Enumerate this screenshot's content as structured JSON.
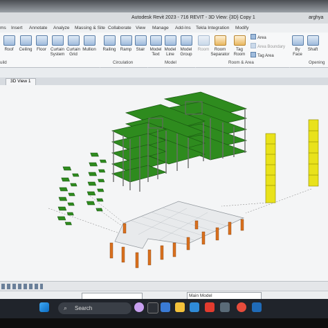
{
  "window": {
    "title": "Autodesk Revit 2023 - 716 REVIT - 3D View: {3D} Copy 1",
    "user": "arghya"
  },
  "tabs": [
    "ms",
    "Insert",
    "Annotate",
    "Analyze",
    "Massing & Site",
    "Collaborate",
    "View",
    "Manage",
    "Add-Ins",
    "Tekla Integration",
    "Modify"
  ],
  "ribbon": {
    "buttons": [
      {
        "label": "Roof"
      },
      {
        "label": "Ceiling"
      },
      {
        "label": "Floor"
      },
      {
        "label": "Curtain\nSystem"
      },
      {
        "label": "Curtain\nGrid"
      },
      {
        "label": "Mullion"
      },
      {
        "label": "Railing"
      },
      {
        "label": "Ramp"
      },
      {
        "label": "Stair"
      },
      {
        "label": "Model\nText"
      },
      {
        "label": "Model\nLine"
      },
      {
        "label": "Model\nGroup"
      },
      {
        "label": "Room"
      },
      {
        "label": "Room\nSeparator"
      },
      {
        "label": "Tag\nRoom"
      },
      {
        "label": "By\nFace"
      },
      {
        "label": "Shaft"
      }
    ],
    "small_items": [
      "Area",
      "Area Boundary",
      "Tag Area"
    ],
    "panels": [
      "uild",
      "Circulation",
      "Model",
      "Room & Area",
      "Opening"
    ]
  },
  "view_tab": {
    "label": "3D View 1"
  },
  "status_bar": {
    "model": "Main Model"
  },
  "taskbar": {
    "search": "Search"
  },
  "colors": {
    "slab": "#2e8b1e",
    "column_yellow": "#e9e21b",
    "column_orange": "#d9701e"
  }
}
